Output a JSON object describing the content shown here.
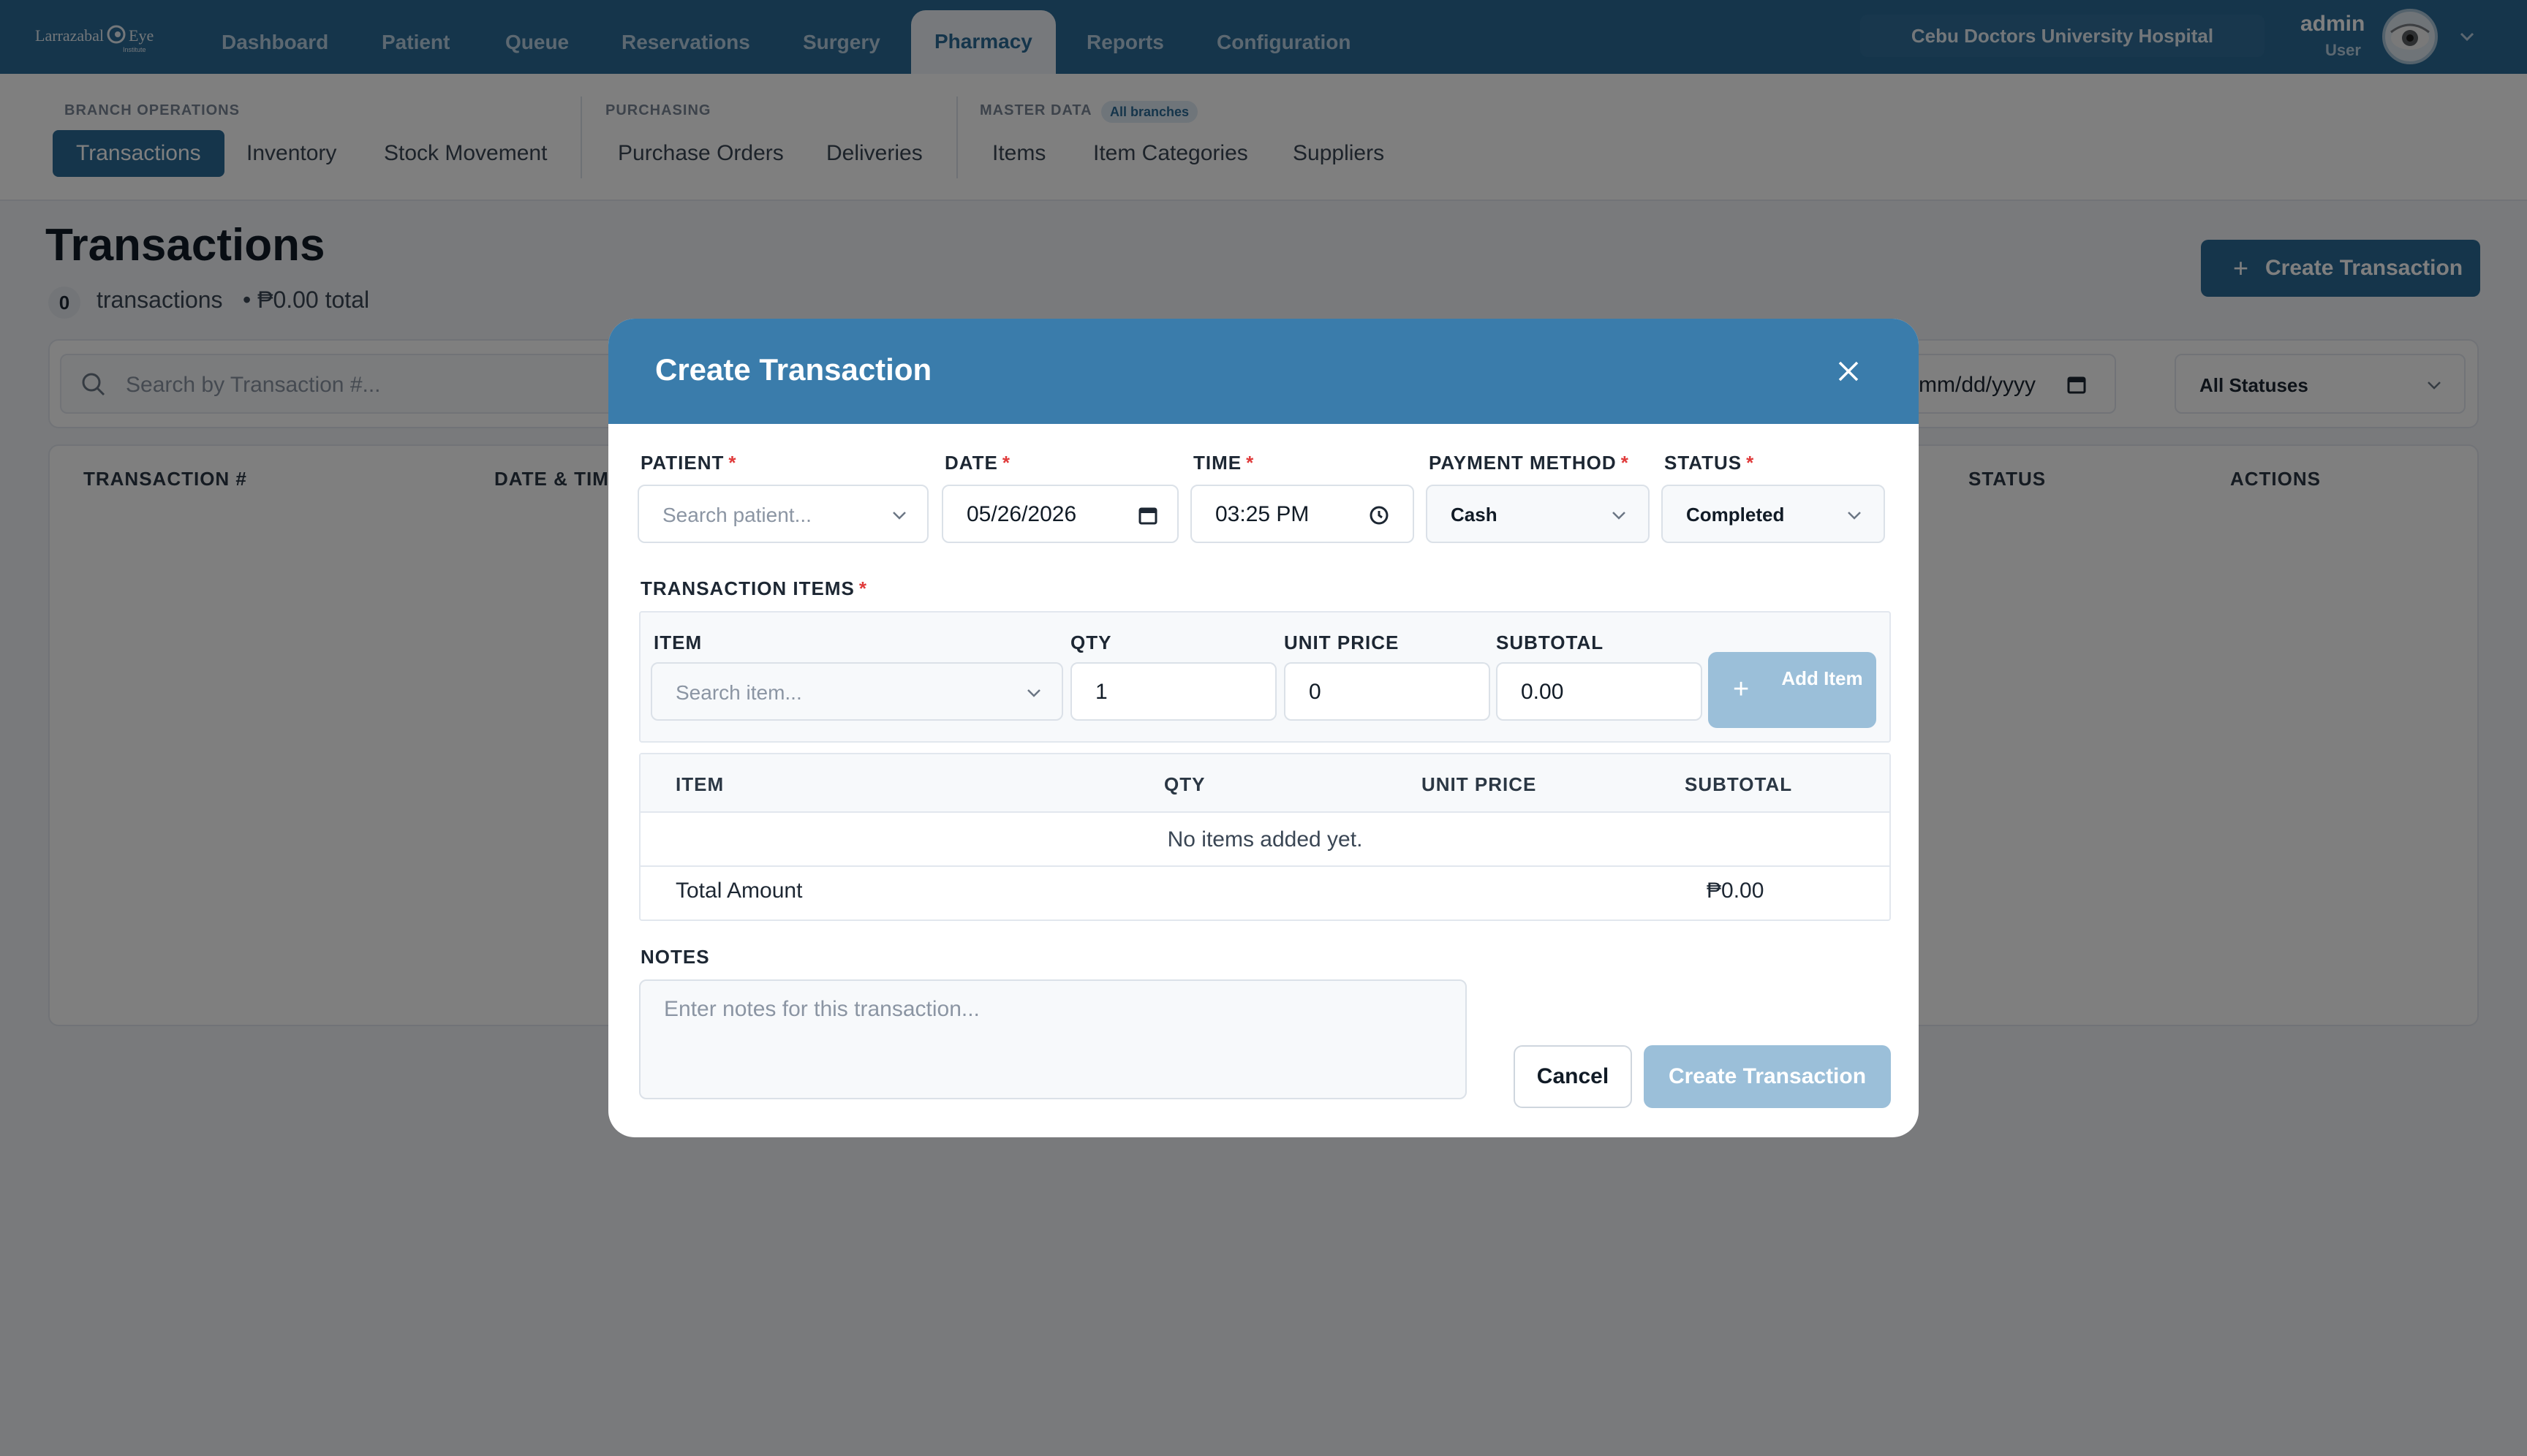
{
  "app": {
    "logo_text": [
      "Larrazabal",
      "Eye",
      "Institute"
    ],
    "nav": [
      {
        "label": "Dashboard"
      },
      {
        "label": "Patient"
      },
      {
        "label": "Queue"
      },
      {
        "label": "Reservations"
      },
      {
        "label": "Surgery"
      },
      {
        "label": "Pharmacy",
        "active": true
      },
      {
        "label": "Reports"
      },
      {
        "label": "Configuration"
      }
    ],
    "hospital": "Cebu Doctors University Hospital",
    "user": {
      "name": "admin",
      "role": "User"
    }
  },
  "subnav": {
    "groups": [
      {
        "label": "BRANCH OPERATIONS",
        "items": [
          "Transactions",
          "Inventory",
          "Stock Movement"
        ]
      },
      {
        "label": "PURCHASING",
        "items": [
          "Purchase Orders",
          "Deliveries"
        ]
      },
      {
        "label": "MASTER DATA",
        "badge": "All branches",
        "items": [
          "Items",
          "Item Categories",
          "Suppliers"
        ]
      }
    ],
    "active": "Transactions"
  },
  "page": {
    "title": "Transactions",
    "count": "0",
    "count_label": "transactions",
    "total_label": "• ₱0.00 total",
    "create_button": "Create Transaction",
    "search_placeholder": "Search by Transaction #...",
    "date_filter": "mm/dd/yyyy",
    "status_filter": "All Statuses",
    "columns": [
      "TRANSACTION #",
      "DATE & TIME",
      "STATUS",
      "ACTIONS"
    ]
  },
  "modal": {
    "title": "Create Transaction",
    "fields": {
      "patient": {
        "label": "PATIENT",
        "placeholder": "Search patient..."
      },
      "date": {
        "label": "DATE",
        "value": "05/26/2026"
      },
      "time": {
        "label": "TIME",
        "value": "03:25 PM"
      },
      "payment": {
        "label": "PAYMENT METHOD",
        "value": "Cash"
      },
      "status": {
        "label": "STATUS",
        "value": "Completed"
      }
    },
    "items_section": {
      "label": "TRANSACTION ITEMS",
      "item_label": "ITEM",
      "item_placeholder": "Search item...",
      "qty_label": "QTY",
      "qty_value": "1",
      "unit_price_label": "UNIT PRICE",
      "unit_price_value": "0",
      "subtotal_label": "SUBTOTAL",
      "subtotal_value": "0.00",
      "add_button": "Add Item"
    },
    "items_table": {
      "columns": [
        "ITEM",
        "QTY",
        "UNIT PRICE",
        "SUBTOTAL"
      ],
      "empty": "No items added yet.",
      "total_label": "Total Amount",
      "total_value": "₱0.00"
    },
    "notes": {
      "label": "NOTES",
      "placeholder": "Enter notes for this transaction..."
    },
    "cancel_button": "Cancel",
    "submit_button": "Create Transaction"
  },
  "colors": {
    "primary": "#2b6a96",
    "modal_header": "#3a7cab",
    "disabled_button": "#9bbfd9",
    "required": "#e03a3a"
  },
  "icons": [
    "eye-logo-icon",
    "chevron-down-icon",
    "plus-icon",
    "search-icon",
    "calendar-icon",
    "clock-icon",
    "close-icon"
  ]
}
